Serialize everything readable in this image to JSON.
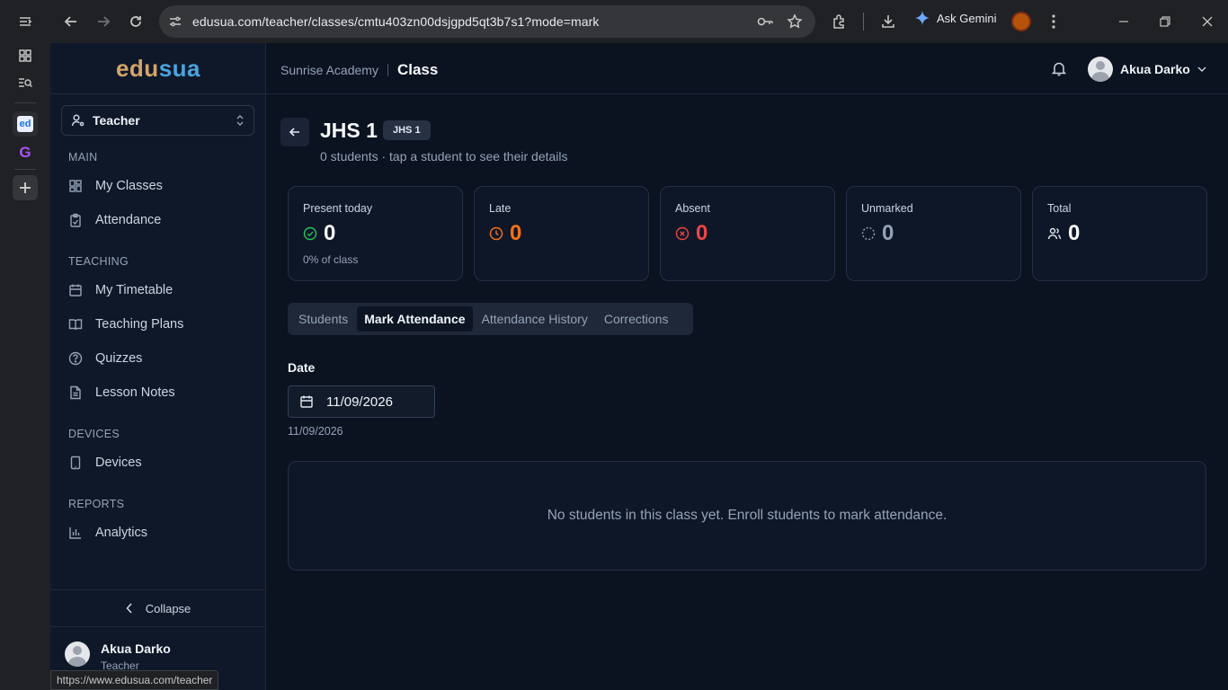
{
  "browser": {
    "url": "edusua.com/teacher/classes/cmtu403zn00dsjgpd5qt3b7s1?mode=mark",
    "gemini_label": "Ask Gemini",
    "status_url": "https://www.edusua.com/teacher"
  },
  "sidebar": {
    "logo_part1": "edu",
    "logo_part2": "sua",
    "role": "Teacher",
    "sections": {
      "main": "MAIN",
      "teaching": "TEACHING",
      "devices": "DEVICES",
      "reports": "REPORTS"
    },
    "items": {
      "my_classes": "My Classes",
      "attendance": "Attendance",
      "my_timetable": "My Timetable",
      "teaching_plans": "Teaching Plans",
      "quizzes": "Quizzes",
      "lesson_notes": "Lesson Notes",
      "devices": "Devices",
      "analytics": "Analytics"
    },
    "collapse": "Collapse",
    "profile": {
      "name": "Akua Darko",
      "role": "Teacher"
    }
  },
  "header": {
    "school": "Sunrise Academy",
    "page": "Class",
    "user": "Akua Darko"
  },
  "class": {
    "title": "JHS 1",
    "badge": "JHS 1",
    "subtitle": "0 students · tap a student to see their details"
  },
  "stats": {
    "present": {
      "label": "Present today",
      "value": "0",
      "sub": "0% of class"
    },
    "late": {
      "label": "Late",
      "value": "0"
    },
    "absent": {
      "label": "Absent",
      "value": "0"
    },
    "unmarked": {
      "label": "Unmarked",
      "value": "0"
    },
    "total": {
      "label": "Total",
      "value": "0"
    }
  },
  "tabs": {
    "students": "Students",
    "mark": "Mark Attendance",
    "history": "Attendance History",
    "corrections": "Corrections"
  },
  "attendance": {
    "date_label": "Date",
    "date_value": "11/09/2026",
    "date_echo": "11/09/2026",
    "empty_message": "No students in this class yet. Enroll students to mark attendance."
  },
  "colors": {
    "present": "#22c55e",
    "late": "#f97316",
    "absent": "#ef4444",
    "unmarked": "#94a3b8"
  }
}
